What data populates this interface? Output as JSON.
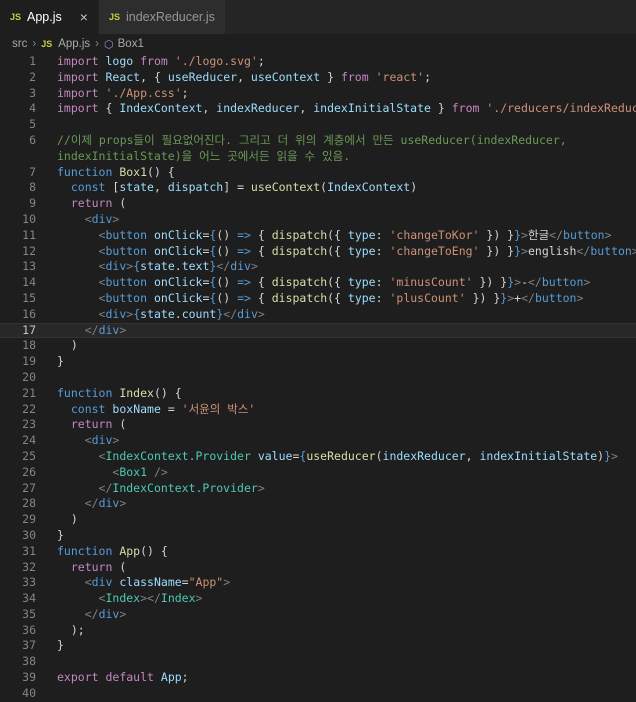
{
  "tabs": [
    {
      "icon": "JS",
      "label": "App.js",
      "close": "×"
    },
    {
      "icon": "JS",
      "label": "indexReducer.js"
    }
  ],
  "breadcrumb": {
    "folder": "src",
    "file_icon": "JS",
    "file": "App.js",
    "symbol": "Box1"
  },
  "code_lines": [
    {
      "n": "1",
      "html": "<span class='c2'>import</span> <span class='v'>logo</span> <span class='c2'>from</span> <span class='s'>'./logo.svg'</span>;"
    },
    {
      "n": "2",
      "html": "<span class='c2'>import</span> <span class='v'>React</span>, { <span class='v'>useReducer</span>, <span class='v'>useContext</span> } <span class='c2'>from</span> <span class='s'>'react'</span>;"
    },
    {
      "n": "3",
      "html": "<span class='c2'>import</span> <span class='s'>'./App.css'</span>;"
    },
    {
      "n": "4",
      "html": "<span class='c2'>import</span> { <span class='v'>IndexContext</span>, <span class='v'>indexReducer</span>, <span class='v'>indexInitialState</span> } <span class='c2'>from</span> <span class='s'>'./reducers/indexReducer'</span>;"
    },
    {
      "n": "5",
      "html": ""
    },
    {
      "n": "6",
      "html": "<span class='cm'>//이제 props들이 필요없어진다. 그리고 더 위의 계층에서 만든 useReducer(indexReducer,</span>"
    },
    {
      "n": "",
      "html": "<span class='cm'>indexInitialState)을 어느 곳에서든 읽을 수 있음.</span>"
    },
    {
      "n": "7",
      "html": "<span class='k'>function</span> <span class='f'>Box1</span>() {"
    },
    {
      "n": "8",
      "html": "  <span class='k'>const</span> [<span class='v'>state</span>, <span class='v'>dispatch</span>] = <span class='f'>useContext</span>(<span class='v'>IndexContext</span>)"
    },
    {
      "n": "9",
      "html": "  <span class='c2'>return</span> ("
    },
    {
      "n": "10",
      "html": "    <span class='g'>&lt;</span><span class='k'>div</span><span class='g'>&gt;</span>"
    },
    {
      "n": "11",
      "html": "      <span class='g'>&lt;</span><span class='k'>button</span> <span class='v'>onClick</span>=<span class='k'>{</span>() <span class='k'>=&gt;</span> { <span class='f'>dispatch</span>({ <span class='v'>type</span>: <span class='s'>'changeToKor'</span> }) }<span class='k'>}</span><span class='g'>&gt;</span>한글<span class='g'>&lt;/</span><span class='k'>button</span><span class='g'>&gt;</span>"
    },
    {
      "n": "12",
      "html": "      <span class='g'>&lt;</span><span class='k'>button</span> <span class='v'>onClick</span>=<span class='k'>{</span>() <span class='k'>=&gt;</span> { <span class='f'>dispatch</span>({ <span class='v'>type</span>: <span class='s'>'changeToEng'</span> }) }<span class='k'>}</span><span class='g'>&gt;</span>english<span class='g'>&lt;/</span><span class='k'>button</span><span class='g'>&gt;</span>"
    },
    {
      "n": "13",
      "html": "      <span class='g'>&lt;</span><span class='k'>div</span><span class='g'>&gt;</span><span class='k'>{</span><span class='v'>state</span>.<span class='v'>text</span><span class='k'>}</span><span class='g'>&lt;/</span><span class='k'>div</span><span class='g'>&gt;</span>"
    },
    {
      "n": "14",
      "html": "      <span class='g'>&lt;</span><span class='k'>button</span> <span class='v'>onClick</span>=<span class='k'>{</span>() <span class='k'>=&gt;</span> { <span class='f'>dispatch</span>({ <span class='v'>type</span>: <span class='s'>'minusCount'</span> }) }<span class='k'>}</span><span class='g'>&gt;</span>-<span class='g'>&lt;/</span><span class='k'>button</span><span class='g'>&gt;</span>"
    },
    {
      "n": "15",
      "html": "      <span class='g'>&lt;</span><span class='k'>button</span> <span class='v'>onClick</span>=<span class='k'>{</span>() <span class='k'>=&gt;</span> { <span class='f'>dispatch</span>({ <span class='v'>type</span>: <span class='s'>'plusCount'</span> }) }<span class='k'>}</span><span class='g'>&gt;</span>+<span class='g'>&lt;/</span><span class='k'>button</span><span class='g'>&gt;</span>"
    },
    {
      "n": "16",
      "html": "      <span class='g'>&lt;</span><span class='k'>div</span><span class='g'>&gt;</span><span class='k'>{</span><span class='v'>state</span>.<span class='v'>count</span><span class='k'>}</span><span class='g'>&lt;/</span><span class='k'>div</span><span class='g'>&gt;</span>"
    },
    {
      "n": "17",
      "html": "    <span class='g'>&lt;/</span><span class='k'>div</span><span class='g'>&gt;</span>",
      "current": true
    },
    {
      "n": "18",
      "html": "  )"
    },
    {
      "n": "19",
      "html": "}"
    },
    {
      "n": "20",
      "html": ""
    },
    {
      "n": "21",
      "html": "<span class='k'>function</span> <span class='f'>Index</span>() {"
    },
    {
      "n": "22",
      "html": "  <span class='k'>const</span> <span class='v'>boxName</span> = <span class='s'>'서윤의 박스'</span>"
    },
    {
      "n": "23",
      "html": "  <span class='c2'>return</span> ("
    },
    {
      "n": "24",
      "html": "    <span class='g'>&lt;</span><span class='k'>div</span><span class='g'>&gt;</span>"
    },
    {
      "n": "25",
      "html": "      <span class='g'>&lt;</span><span class='t'>IndexContext.Provider</span> <span class='v'>value</span>=<span class='k'>{</span><span class='f'>useReducer</span>(<span class='v'>indexReducer</span>, <span class='v'>indexInitialState</span>)<span class='k'>}</span><span class='g'>&gt;</span>"
    },
    {
      "n": "26",
      "html": "        <span class='g'>&lt;</span><span class='t'>Box1</span> <span class='g'>/&gt;</span>"
    },
    {
      "n": "27",
      "html": "      <span class='g'>&lt;/</span><span class='t'>IndexContext.Provider</span><span class='g'>&gt;</span>"
    },
    {
      "n": "28",
      "html": "    <span class='g'>&lt;/</span><span class='k'>div</span><span class='g'>&gt;</span>"
    },
    {
      "n": "29",
      "html": "  )"
    },
    {
      "n": "30",
      "html": "}"
    },
    {
      "n": "31",
      "html": "<span class='k'>function</span> <span class='f'>App</span>() {"
    },
    {
      "n": "32",
      "html": "  <span class='c2'>return</span> ("
    },
    {
      "n": "33",
      "html": "    <span class='g'>&lt;</span><span class='k'>div</span> <span class='v'>className</span>=<span class='s'>\"App\"</span><span class='g'>&gt;</span>"
    },
    {
      "n": "34",
      "html": "      <span class='g'>&lt;</span><span class='t'>Index</span><span class='g'>&gt;&lt;/</span><span class='t'>Index</span><span class='g'>&gt;</span>"
    },
    {
      "n": "35",
      "html": "    <span class='g'>&lt;/</span><span class='k'>div</span><span class='g'>&gt;</span>"
    },
    {
      "n": "36",
      "html": "  );"
    },
    {
      "n": "37",
      "html": "}"
    },
    {
      "n": "38",
      "html": ""
    },
    {
      "n": "39",
      "html": "<span class='c2'>export</span> <span class='c2'>default</span> <span class='v'>App</span>;"
    },
    {
      "n": "40",
      "html": ""
    }
  ]
}
